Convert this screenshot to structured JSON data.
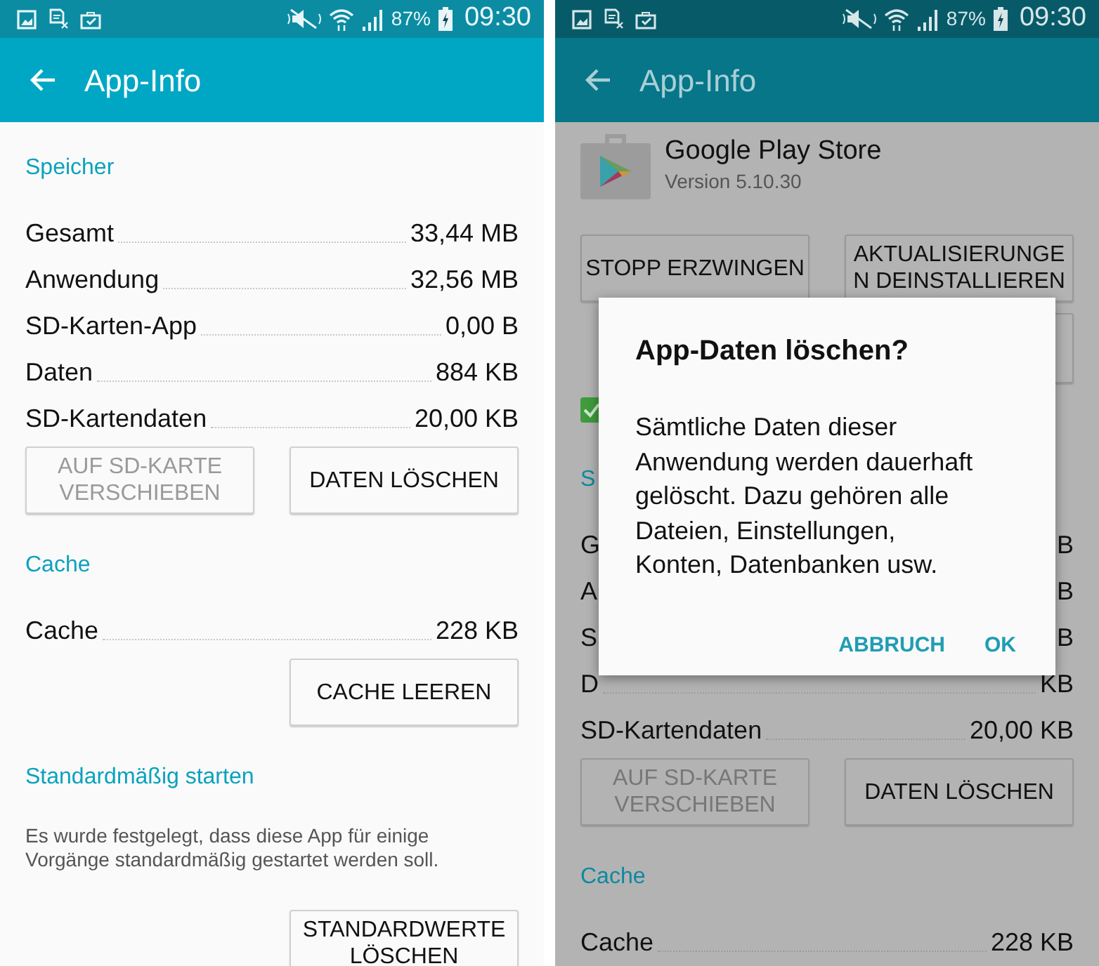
{
  "screens": [
    {
      "status_bar": {
        "battery": "87%",
        "time": "09:30"
      },
      "app_bar": {
        "title": "App-Info"
      },
      "sections": [
        {
          "header": "Speicher",
          "rows": [
            {
              "label": "Gesamt",
              "value": "33,44 MB"
            },
            {
              "label": "Anwendung",
              "value": "32,56 MB"
            },
            {
              "label": "SD-Karten-App",
              "value": "0,00 B"
            },
            {
              "label": "Daten",
              "value": "884 KB"
            },
            {
              "label": "SD-Kartendaten",
              "value": "20,00 KB"
            }
          ],
          "buttons": [
            {
              "lines": [
                "AUF SD-KARTE",
                "VERSCHIEBEN"
              ],
              "disabled": true
            },
            {
              "lines": [
                "DATEN LÖSCHEN"
              ],
              "disabled": false
            }
          ]
        },
        {
          "header": "Cache",
          "rows": [
            {
              "label": "Cache",
              "value": "228 KB"
            }
          ],
          "buttons": [
            {
              "lines": [
                "CACHE LEEREN"
              ],
              "disabled": false
            }
          ]
        },
        {
          "header": "Standardmäßig starten",
          "text": "Es wurde festgelegt, dass diese App für einige Vorgänge standardmäßig gestartet werden soll.",
          "buttons": [
            {
              "lines": [
                "STANDARDWERTE",
                "LÖSCHEN"
              ],
              "disabled": false
            }
          ]
        }
      ]
    },
    {
      "status_bar": {
        "battery": "87%",
        "time": "09:30"
      },
      "app_bar": {
        "title": "App-Info"
      },
      "app": {
        "name": "Google Play Store",
        "version": "Version 5.10.30"
      },
      "app_buttons": [
        {
          "lines": [
            "STOPP ERZWINGEN"
          ],
          "disabled": false
        },
        {
          "lines": [
            "AKTUALISIERUNGE",
            "N DEINSTALLIEREN"
          ],
          "disabled": false
        }
      ],
      "notification_checkbox": {
        "checked": true
      },
      "sections": [
        {
          "header": "S",
          "rows": [
            {
              "label": "G",
              "value": "B"
            },
            {
              "label": "A",
              "value": "B"
            },
            {
              "label": "S",
              "value": "B"
            },
            {
              "label": "D",
              "value": "KB"
            },
            {
              "label": "SD-Kartendaten",
              "value": "20,00 KB"
            }
          ],
          "buttons": [
            {
              "lines": [
                "AUF SD-KARTE",
                "VERSCHIEBEN"
              ],
              "disabled": true
            },
            {
              "lines": [
                "DATEN LÖSCHEN"
              ],
              "disabled": false
            }
          ]
        },
        {
          "header": "Cache",
          "rows": [
            {
              "label": "Cache",
              "value": "228 KB"
            }
          ]
        }
      ],
      "dialog": {
        "title": "App-Daten löschen?",
        "message": "Sämtliche Daten dieser Anwendung werden dauerhaft gelöscht. Dazu gehören alle Dateien, Einstellungen, Konten, Datenbanken usw.",
        "actions": [
          "ABBRUCH",
          "OK"
        ]
      }
    }
  ]
}
